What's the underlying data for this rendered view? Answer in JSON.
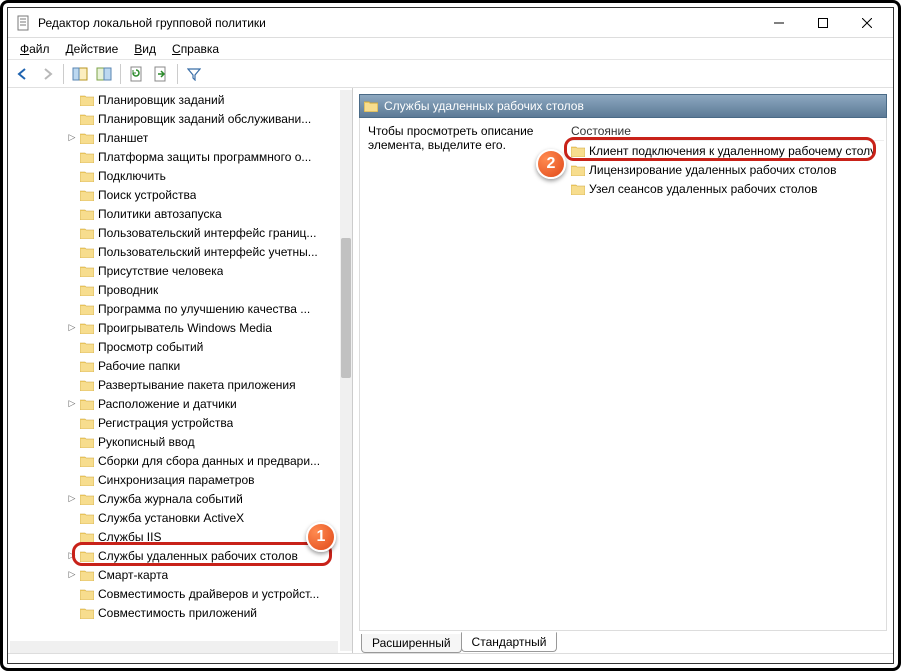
{
  "titlebar": {
    "title": "Редактор локальной групповой политики"
  },
  "menubar": {
    "file": "Файл",
    "action": "Действие",
    "view": "Вид",
    "help": "Справка"
  },
  "tree": {
    "items": [
      {
        "label": "Планировщик заданий",
        "expandable": false
      },
      {
        "label": "Планировщик заданий обслуживани...",
        "expandable": false
      },
      {
        "label": "Планшет",
        "expandable": true
      },
      {
        "label": "Платформа защиты программного о...",
        "expandable": false
      },
      {
        "label": "Подключить",
        "expandable": false
      },
      {
        "label": "Поиск устройства",
        "expandable": false
      },
      {
        "label": "Политики автозапуска",
        "expandable": false
      },
      {
        "label": "Пользовательский интерфейс границ...",
        "expandable": false
      },
      {
        "label": "Пользовательский интерфейс учетны...",
        "expandable": false
      },
      {
        "label": "Присутствие человека",
        "expandable": false
      },
      {
        "label": "Проводник",
        "expandable": false
      },
      {
        "label": "Программа по улучшению качества ...",
        "expandable": false
      },
      {
        "label": "Проигрыватель Windows Media",
        "expandable": true
      },
      {
        "label": "Просмотр событий",
        "expandable": false
      },
      {
        "label": "Рабочие папки",
        "expandable": false
      },
      {
        "label": "Развертывание пакета приложения",
        "expandable": false
      },
      {
        "label": "Расположение и датчики",
        "expandable": true
      },
      {
        "label": "Регистрация устройства",
        "expandable": false
      },
      {
        "label": "Рукописный ввод",
        "expandable": false
      },
      {
        "label": "Сборки для сбора данных и предвари...",
        "expandable": false
      },
      {
        "label": "Синхронизация параметров",
        "expandable": false
      },
      {
        "label": "Служба журнала событий",
        "expandable": true
      },
      {
        "label": "Служба установки ActiveX",
        "expandable": false
      },
      {
        "label": "Службы IIS",
        "expandable": false
      },
      {
        "label": "Службы удаленных рабочих столов",
        "expandable": true,
        "highlighted": true
      },
      {
        "label": "Смарт-карта",
        "expandable": true
      },
      {
        "label": "Совместимость драйверов и устройст...",
        "expandable": false
      },
      {
        "label": "Совместимость приложений",
        "expandable": false
      }
    ]
  },
  "right": {
    "header": "Службы удаленных рабочих столов",
    "desc": "Чтобы просмотреть описание элемента, выделите его.",
    "column": "Состояние",
    "items": [
      {
        "label": "Клиент подключения к удаленному рабочему столу",
        "highlighted": true
      },
      {
        "label": "Лицензирование удаленных рабочих столов"
      },
      {
        "label": "Узел сеансов удаленных рабочих столов"
      }
    ]
  },
  "tabs": {
    "extended": "Расширенный",
    "standard": "Стандартный"
  },
  "badges": {
    "one": "1",
    "two": "2"
  }
}
